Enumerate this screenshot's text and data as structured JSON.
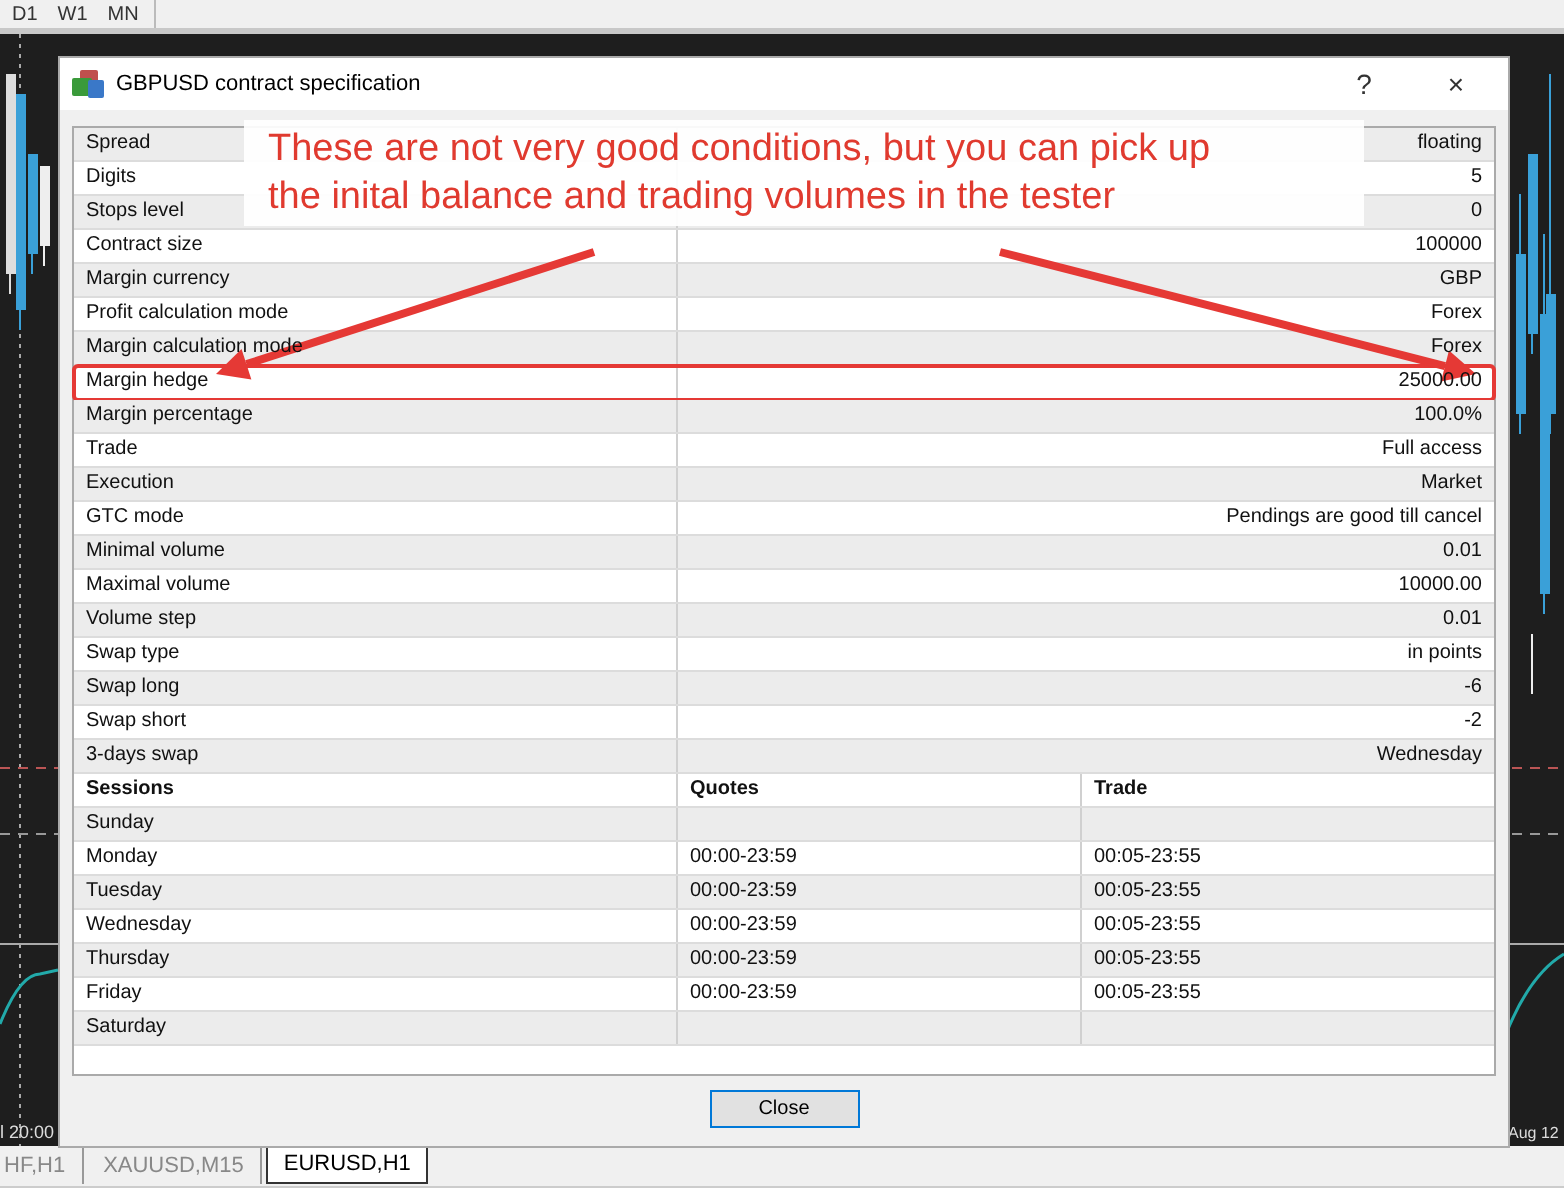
{
  "toolbar": {
    "timeframes": [
      {
        "label": "D1"
      },
      {
        "label": "W1"
      },
      {
        "label": "MN"
      }
    ]
  },
  "chart": {
    "kind": "picture",
    "time_labels": [
      "l 20:00",
      "Aug 12"
    ]
  },
  "dialog": {
    "title": "GBPUSD contract specification",
    "help": "?",
    "close_glyph": "×",
    "spec_rows": [
      {
        "label": "Spread",
        "value": "floating",
        "highlighted": false
      },
      {
        "label": "Digits",
        "value": "5",
        "highlighted": false
      },
      {
        "label": "Stops level",
        "value": "0",
        "highlighted": false
      },
      {
        "label": "Contract size",
        "value": "100000",
        "highlighted": false
      },
      {
        "label": "Margin currency",
        "value": "GBP",
        "highlighted": false
      },
      {
        "label": "Profit calculation mode",
        "value": "Forex",
        "highlighted": false
      },
      {
        "label": "Margin calculation mode",
        "value": "Forex",
        "highlighted": false
      },
      {
        "label": "Margin hedge",
        "value": "25000.00",
        "highlighted": true
      },
      {
        "label": "Margin percentage",
        "value": "100.0%",
        "highlighted": false
      },
      {
        "label": "Trade",
        "value": "Full access",
        "highlighted": false
      },
      {
        "label": "Execution",
        "value": "Market",
        "highlighted": false
      },
      {
        "label": "GTC mode",
        "value": "Pendings are good till cancel",
        "highlighted": false
      },
      {
        "label": "Minimal volume",
        "value": "0.01",
        "highlighted": false
      },
      {
        "label": "Maximal volume",
        "value": "10000.00",
        "highlighted": false
      },
      {
        "label": "Volume step",
        "value": "0.01",
        "highlighted": false
      },
      {
        "label": "Swap type",
        "value": "in points",
        "highlighted": false
      },
      {
        "label": "Swap long",
        "value": "-6",
        "highlighted": false
      },
      {
        "label": "Swap short",
        "value": "-2",
        "highlighted": false
      },
      {
        "label": "3-days swap",
        "value": "Wednesday",
        "highlighted": false
      }
    ],
    "sessions": {
      "columns": [
        "Sessions",
        "Quotes",
        "Trade"
      ],
      "rows": [
        {
          "day": "Sunday"
        },
        {
          "day": "Monday",
          "quotes": "00:00-23:59",
          "trade": "00:05-23:55"
        },
        {
          "day": "Tuesday",
          "quotes": "00:00-23:59",
          "trade": "00:05-23:55"
        },
        {
          "day": "Wednesday",
          "quotes": "00:00-23:59",
          "trade": "00:05-23:55"
        },
        {
          "day": "Thursday",
          "quotes": "00:00-23:59",
          "trade": "00:05-23:55"
        },
        {
          "day": "Friday",
          "quotes": "00:00-23:59",
          "trade": "00:05-23:55"
        },
        {
          "day": "Saturday"
        }
      ]
    },
    "button": "Close"
  },
  "annotation": {
    "text": "These are not very good conditions, but you can pick up\nthe inital balance and trading volumes in the tester"
  },
  "chart_tabs": [
    {
      "label": "HF,H1",
      "selected": false
    },
    {
      "label": "XAUUSD,M15",
      "selected": false
    },
    {
      "label": "EURUSD,H1",
      "selected": true
    }
  ]
}
